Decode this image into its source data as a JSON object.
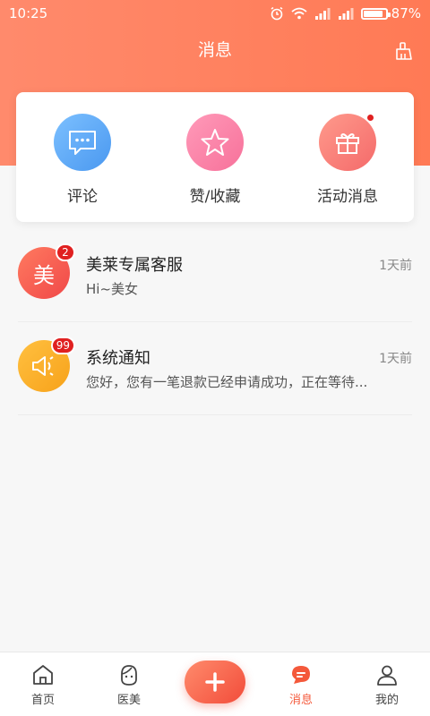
{
  "status": {
    "time": "10:25",
    "battery": "87%"
  },
  "header": {
    "title": "消息"
  },
  "quick_actions": [
    {
      "label": "评论",
      "icon": "comment-icon",
      "color": "#5aa8f7"
    },
    {
      "label": "赞/收藏",
      "icon": "star-icon",
      "color": "#f97ca2"
    },
    {
      "label": "活动消息",
      "icon": "gift-icon",
      "color": "#f77272",
      "has_dot": true
    }
  ],
  "messages": [
    {
      "title": "美莱专属客服",
      "preview": "Hi~美女",
      "time": "1天前",
      "badge": "2",
      "avatar_text": "美"
    },
    {
      "title": "系统通知",
      "preview": "您好，您有一笔退款已经申请成功，正在等待...",
      "time": "1天前",
      "badge": "99",
      "avatar_icon": "megaphone-icon"
    }
  ],
  "tabbar": [
    {
      "label": "首页",
      "icon": "home-icon"
    },
    {
      "label": "医美",
      "icon": "face-icon"
    },
    {
      "label": "",
      "icon": "plus-icon"
    },
    {
      "label": "消息",
      "icon": "message-icon",
      "active": true
    },
    {
      "label": "我的",
      "icon": "user-icon"
    }
  ],
  "colors": {
    "accent": "#f4593b",
    "header": "#ff7f5e"
  }
}
